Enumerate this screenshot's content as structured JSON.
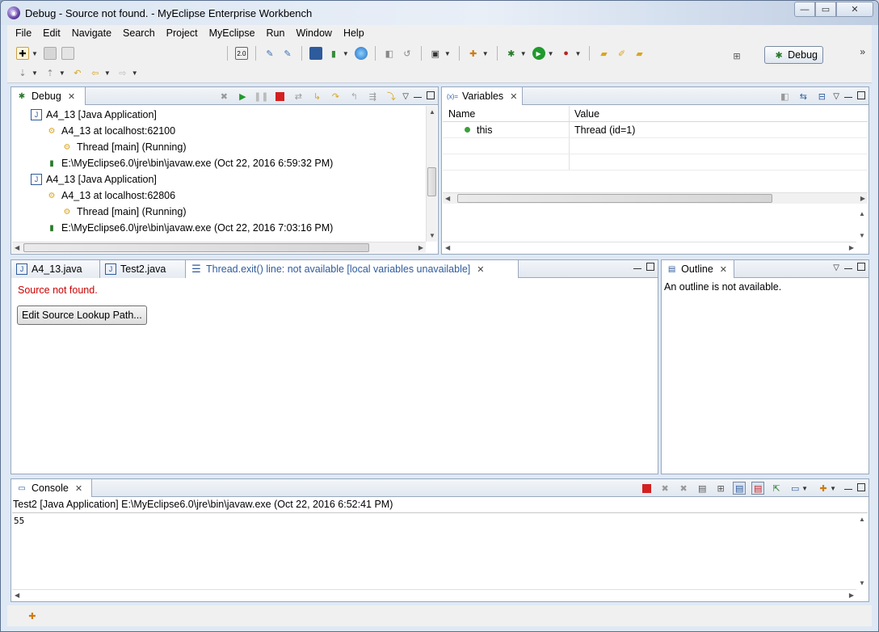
{
  "window": {
    "title": "Debug - Source not found. - MyEclipse Enterprise Workbench",
    "controls": {
      "minimize": "—",
      "maximize": "▭",
      "close": "✕"
    }
  },
  "menu": [
    "File",
    "Edit",
    "Navigate",
    "Search",
    "Project",
    "MyEclipse",
    "Run",
    "Window",
    "Help"
  ],
  "perspective": {
    "label": "Debug"
  },
  "debug_view": {
    "tab_label": "Debug",
    "items": [
      {
        "label": "A4_13 [Java Application]",
        "kind": "launch"
      },
      {
        "label": "A4_13 at localhost:62100",
        "kind": "vm"
      },
      {
        "label": "Thread [main] (Running)",
        "kind": "thread"
      },
      {
        "label": "E:\\MyEclipse6.0\\jre\\bin\\javaw.exe (Oct 22, 2016 6:59:32 PM)",
        "kind": "process"
      },
      {
        "label": "A4_13 [Java Application]",
        "kind": "launch"
      },
      {
        "label": "A4_13 at localhost:62806",
        "kind": "vm"
      },
      {
        "label": "Thread [main] (Running)",
        "kind": "thread"
      },
      {
        "label": "E:\\MyEclipse6.0\\jre\\bin\\javaw.exe (Oct 22, 2016 7:03:16 PM)",
        "kind": "process"
      }
    ]
  },
  "variables_view": {
    "tab_label": "Variables",
    "columns": {
      "name": "Name",
      "value": "Value"
    },
    "rows": [
      {
        "name": "this",
        "value": "Thread  (id=1)"
      }
    ]
  },
  "editor": {
    "tabs": [
      {
        "label": "A4_13.java",
        "active": false
      },
      {
        "label": "Test2.java",
        "active": false
      },
      {
        "label": "Thread.exit() line: not available [local variables unavailable]",
        "active": true
      }
    ],
    "message": "Source not found.",
    "button_label": "Edit Source Lookup Path..."
  },
  "outline_view": {
    "tab_label": "Outline",
    "message": "An outline is not available."
  },
  "console_view": {
    "tab_label": "Console",
    "process": "Test2 [Java Application] E:\\MyEclipse6.0\\jre\\bin\\javaw.exe (Oct 22, 2016 6:52:41 PM)",
    "output": "55"
  },
  "colors": {
    "error_text": "#cc0000",
    "terminate_red": "#d42020",
    "resume_green": "#1f9a2c",
    "tab_border": "#99a8bd"
  }
}
